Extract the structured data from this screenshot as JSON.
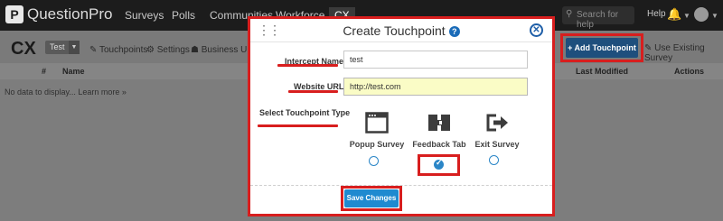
{
  "nav": {
    "logo_mark": "P",
    "logo_text": "QuestionPro",
    "items": [
      "Surveys",
      "Polls",
      "Communities",
      "Workforce",
      "CX"
    ],
    "search_placeholder": "Search for help",
    "help_label": "Help"
  },
  "subheader": {
    "title": "CX",
    "survey_chip": "Test",
    "links": [
      "Touchpoints",
      "Settings",
      "Business Unit"
    ],
    "add_touchpoint_label": "+ Add Touchpoint",
    "use_existing_label": "Use Existing Survey"
  },
  "table": {
    "headers": [
      "#",
      "Name",
      "Last Modified",
      "Actions"
    ],
    "empty_text": "No data to display...",
    "learn_more": "Learn more »"
  },
  "modal": {
    "title": "Create Touchpoint",
    "help_icon": "?",
    "close_icon": "✕",
    "intercept_label": "Intercept Name",
    "intercept_value": "test",
    "website_label": "Website URL",
    "website_value": "http://test.com",
    "type_label": "Select Touchpoint Type",
    "types": [
      {
        "label": "Popup Survey",
        "icon": "browser-window-icon",
        "checked": false
      },
      {
        "label": "Feedback Tab",
        "icon": "feedback-tab-icon",
        "checked": true
      },
      {
        "label": "Exit Survey",
        "icon": "exit-door-icon",
        "checked": false
      }
    ],
    "save_label": "Save Changes"
  },
  "colors": {
    "highlight": "#d81e1e",
    "primary": "#1f8ad0",
    "navy": "#1e4f7d",
    "url_field_bg": "#fafcc6"
  }
}
